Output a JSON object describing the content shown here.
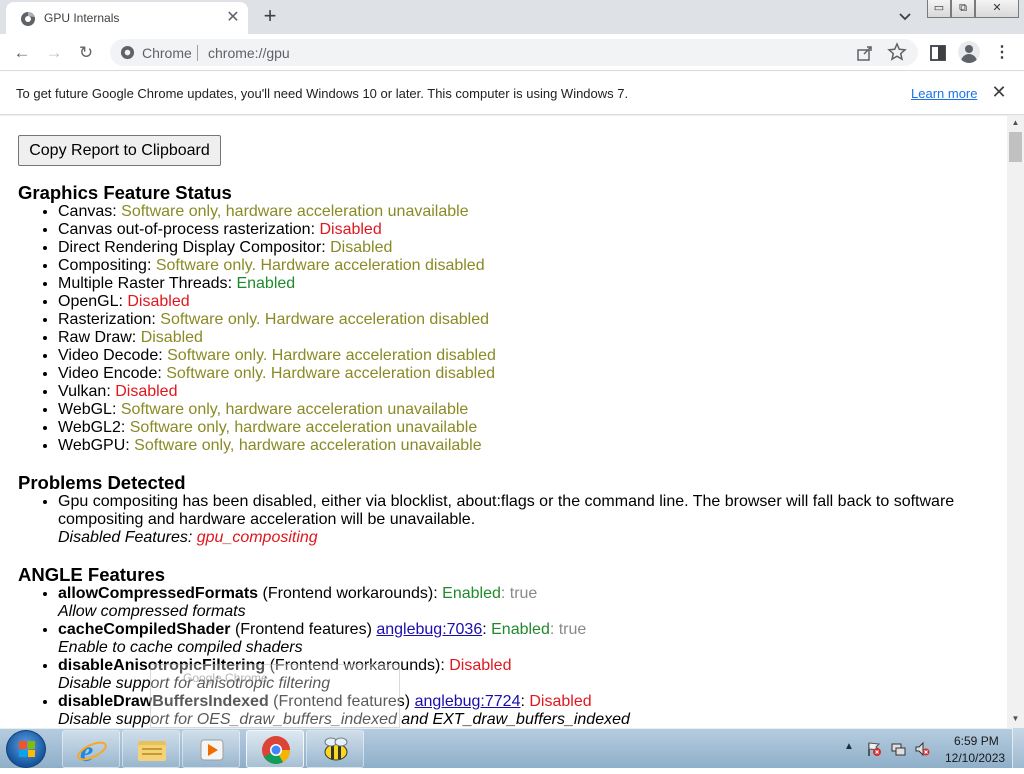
{
  "tab": {
    "title": "GPU Internals",
    "close_glyph": "✕",
    "new_tab_glyph": "+"
  },
  "window_controls": {
    "minimize": "▭",
    "restore": "⧉",
    "close": "✕"
  },
  "toolbar": {
    "back_glyph": "←",
    "forward_glyph": "→",
    "reload_glyph": "↻",
    "omnibox_chip": "Chrome",
    "url": "chrome://gpu",
    "menu_glyph": "⋮"
  },
  "infobar": {
    "message": "To get future Google Chrome updates, you'll need Windows 10 or later. This computer is using Windows 7.",
    "link": "Learn more",
    "close_glyph": "✕"
  },
  "page": {
    "copy_button": "Copy Report to Clipboard",
    "graphics_title": "Graphics Feature Status",
    "graphics_features": [
      {
        "name": "Canvas",
        "status": "Software only, hardware acceleration unavailable",
        "kind": "soft"
      },
      {
        "name": "Canvas out-of-process rasterization",
        "status": "Disabled",
        "kind": "disabled"
      },
      {
        "name": "Direct Rendering Display Compositor",
        "status": "Disabled",
        "kind": "soft"
      },
      {
        "name": "Compositing",
        "status": "Software only. Hardware acceleration disabled",
        "kind": "soft"
      },
      {
        "name": "Multiple Raster Threads",
        "status": "Enabled",
        "kind": "enabled"
      },
      {
        "name": "OpenGL",
        "status": "Disabled",
        "kind": "disabled"
      },
      {
        "name": "Rasterization",
        "status": "Software only. Hardware acceleration disabled",
        "kind": "soft"
      },
      {
        "name": "Raw Draw",
        "status": "Disabled",
        "kind": "soft"
      },
      {
        "name": "Video Decode",
        "status": "Software only. Hardware acceleration disabled",
        "kind": "soft"
      },
      {
        "name": "Video Encode",
        "status": "Software only. Hardware acceleration disabled",
        "kind": "soft"
      },
      {
        "name": "Vulkan",
        "status": "Disabled",
        "kind": "disabled"
      },
      {
        "name": "WebGL",
        "status": "Software only, hardware acceleration unavailable",
        "kind": "soft"
      },
      {
        "name": "WebGL2",
        "status": "Software only, hardware acceleration unavailable",
        "kind": "soft"
      },
      {
        "name": "WebGPU",
        "status": "Software only, hardware acceleration unavailable",
        "kind": "soft"
      }
    ],
    "problems_title": "Problems Detected",
    "problem_line1": "Gpu compositing has been disabled, either via blocklist, about:flags or the command line. The browser will fall back to software",
    "problem_line2": "compositing and hardware acceleration will be unavailable.",
    "problem_disabled_label": "Disabled Features: ",
    "problem_disabled_value": "gpu_compositing",
    "angle_title": "ANGLE Features",
    "angle_features": [
      {
        "name": "allowCompressedFormats",
        "category": " (Frontend workarounds): ",
        "link": "",
        "status": "Enabled",
        "kind": "enabled",
        "value": ": true",
        "description": "Allow compressed formats"
      },
      {
        "name": "cacheCompiledShader",
        "category": " (Frontend features) ",
        "link": "anglebug:7036",
        "status": "Enabled",
        "kind": "enabled",
        "value": ": true",
        "description": "Enable to cache compiled shaders"
      },
      {
        "name": "disableAnisotropicFiltering",
        "category": " (Frontend workarounds): ",
        "link": "",
        "status": "Disabled",
        "kind": "disabled",
        "value": "",
        "description": "Disable support for anisotropic filtering"
      },
      {
        "name": "disableDrawBuffersIndexed",
        "category": " (Frontend features) ",
        "link": "anglebug:7724",
        "status": "Disabled",
        "kind": "disabled",
        "value": "",
        "description": "Disable support for OES_draw_buffers_indexed and EXT_draw_buffers_indexed"
      }
    ],
    "ghost_text": "Google Chrome"
  },
  "taskbar": {
    "time": "6:59 PM",
    "date": "12/10/2023",
    "tray_arrow": "▲"
  },
  "colors": {
    "soft": "#8a8a25",
    "disabled": "#e0171e",
    "enabled": "#1f8a2b",
    "link": "#1a0dab"
  }
}
